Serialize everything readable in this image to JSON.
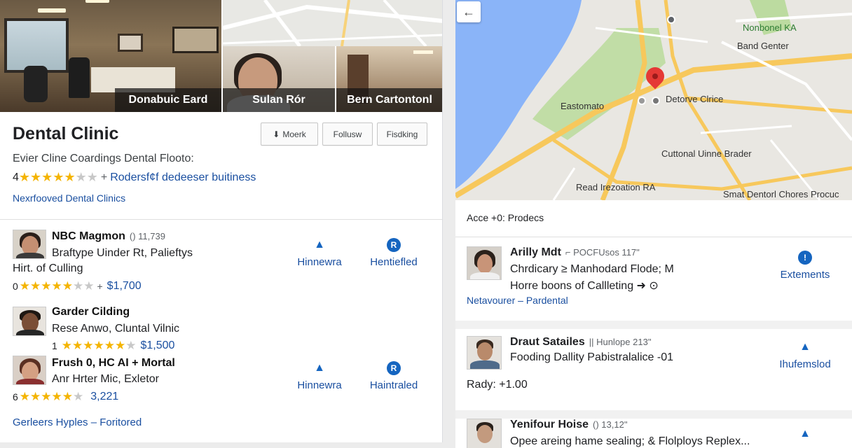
{
  "photos": {
    "main_caption": "Donabuic Eard",
    "doctor_caption": "Sulan Rór",
    "office_caption": "Bern Cartontonl"
  },
  "place": {
    "title": "Dental Clinic",
    "subtitle": "Evier Cline Coardings Dental Flooto:",
    "rating_number": "4",
    "rating_stars": 4,
    "rating_link": "Rodersf¢f dedeeser buitiness",
    "category_link": "Nexrfooved Dental Clinics"
  },
  "actions": {
    "save_label": "Moerk",
    "follow_label": "Follusw",
    "finding_label": "Fisdking"
  },
  "entries": [
    {
      "name": "NBC Magmon",
      "meta": "() 11,739",
      "line1": "Braftype Uinder Rt, Palieftys",
      "line2": "Hirt. of Culling",
      "rating_number": "0",
      "rating_stars": 5,
      "price": "$1,700",
      "action1": "Hinnewra",
      "action1_icon": "drop-icon",
      "action2": "Hentiefled",
      "action2_icon": "badge-icon"
    },
    {
      "name": "Garder Cilding",
      "meta": "",
      "line1": "Rese Anwo, Cluntal Vilnic",
      "line2": "",
      "rating_number": "1",
      "rating_stars": 5,
      "price": "$1,500",
      "action1": "",
      "action2": ""
    },
    {
      "name": "Frush 0, HC AI + Mortal",
      "meta": "",
      "line1": "Anr Hrter Mic, Exletor",
      "line2": "",
      "rating_number": "6",
      "rating_stars": 4,
      "price": "3,221",
      "action1": "Hinnewra",
      "action1_icon": "drop-icon",
      "action2": "Haintraled",
      "action2_icon": "badge-icon"
    }
  ],
  "footer_link": "Gerleers Hyples – Foritored",
  "map": {
    "labels": {
      "top_right": "Nonbonel KA",
      "top_right2": "Band Genter",
      "left": "Eastomato",
      "clinic": "Detorve Clrice",
      "center": "Cuttonal Uinne Brader",
      "bottom": "Read Irezoation RA",
      "bottom_right": "Smat Dentorl Chores Procuc"
    },
    "back_icon": "back-arrow-icon",
    "water_color": "#8ab4f8",
    "park_color": "#bcdba0",
    "road_color": "#f7c85c"
  },
  "right": {
    "section_title": "Acce +0: Prodecs",
    "cards": [
      {
        "name": "Arilly Mdt",
        "meta": "⌐ POCFUsos 117\"",
        "line1": "Chrdicary ≥ Manhodard Flode; M",
        "line2": "Horre boons of Callleting ➜ ⊙",
        "link": "Netavourer – Pardental",
        "action": "Extements",
        "action_icon": "badge-icon"
      },
      {
        "name": "Draut Satailes",
        "meta": "|| Hunlope 213\"",
        "line1": "Fooding Dallity Pabistralalice -01",
        "line2": "Rady: +1.00",
        "link": "",
        "action": "Ihufemslod",
        "action_icon": "drop-icon"
      },
      {
        "name": "Yenifour Hoise",
        "meta": "() 13,12\"",
        "line1": "Opee areing hame sealing; & Flolploys Replex...",
        "line2": "",
        "link": "",
        "action": "",
        "action_icon": "drop-icon"
      }
    ]
  },
  "colors": {
    "accent": "#1a4fa0",
    "star": "#f4b400",
    "pin": "#e53935"
  }
}
